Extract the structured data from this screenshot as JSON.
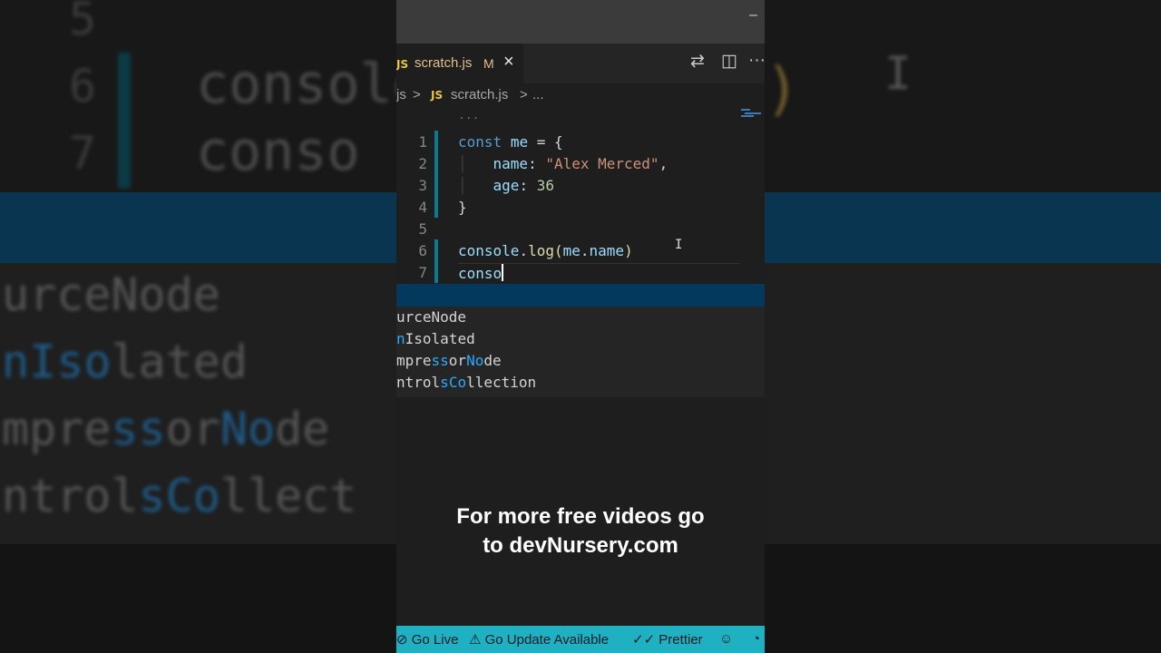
{
  "editor": {
    "tab": {
      "icon": "JS",
      "filename": "scratch.js",
      "modified_flag": "M",
      "close_icon": "×"
    },
    "actions": {
      "compare_icon": "⇄",
      "split_icon": "◫",
      "more_icon": "···"
    },
    "breadcrumb": {
      "folder": "js",
      "sep1": ">",
      "icon": "JS",
      "file": "scratch.js",
      "sep2": ">",
      "more": "..."
    },
    "ellipsis": "...",
    "line_numbers": [
      "1",
      "2",
      "3",
      "4",
      "5",
      "6",
      "7"
    ],
    "code": {
      "l1": {
        "kw": "const",
        "var": "me",
        "rest": " = {"
      },
      "l2": {
        "key": "name",
        "colon": ": ",
        "str": "\"Alex Merced\"",
        "comma": ","
      },
      "l3": {
        "key": "age",
        "colon": ": ",
        "num": "36"
      },
      "l4": {
        "text": "}"
      },
      "l6": {
        "obj": "console",
        "dot": ".",
        "fn": "log",
        "open": "(",
        "arg_obj": "me",
        "arg_dot": ".",
        "arg_prop": "name",
        "close": ")"
      },
      "l7": {
        "text": "conso"
      }
    },
    "text_cursor": "I"
  },
  "suggestions": [
    {
      "pre": "urceNode",
      "hl": "",
      "post": ""
    },
    {
      "pre": "n",
      "hl": "Iso",
      "post": "lated"
    },
    {
      "pre": "mpre",
      "hl": "ss",
      "post": "or",
      "hl2": "No",
      "post2": "de"
    },
    {
      "pre": "ntrol",
      "hl": "s",
      "post": "",
      "hl2": "Co",
      "post2": "llection"
    }
  ],
  "caption": {
    "line1": "For more free videos go",
    "line2": "to devNursery.com"
  },
  "statusbar": {
    "go_live": "⊘ Go Live",
    "update": "⚠ Go Update Available",
    "prettier": "✓✓ Prettier",
    "feedback_icon": "☺",
    "bell_icon": "◔"
  },
  "background": {
    "line_numbers": [
      "5",
      "6",
      "7"
    ],
    "code_line6": "console",
    "code_line7": "conso",
    "paren": ")",
    "cursor_icon": "I",
    "items": [
      {
        "pre": "urceNode",
        "hl": "",
        "post": ""
      },
      {
        "pre": "n",
        "hl": "Iso",
        "post": "lated"
      },
      {
        "pre": "mpre",
        "hl": "ss",
        "post": "or",
        "hl2": "No",
        "post2": "de"
      },
      {
        "pre": "ntrol",
        "hl": "s",
        "post": "",
        "hl2": "Co",
        "post2": "llect"
      }
    ]
  }
}
